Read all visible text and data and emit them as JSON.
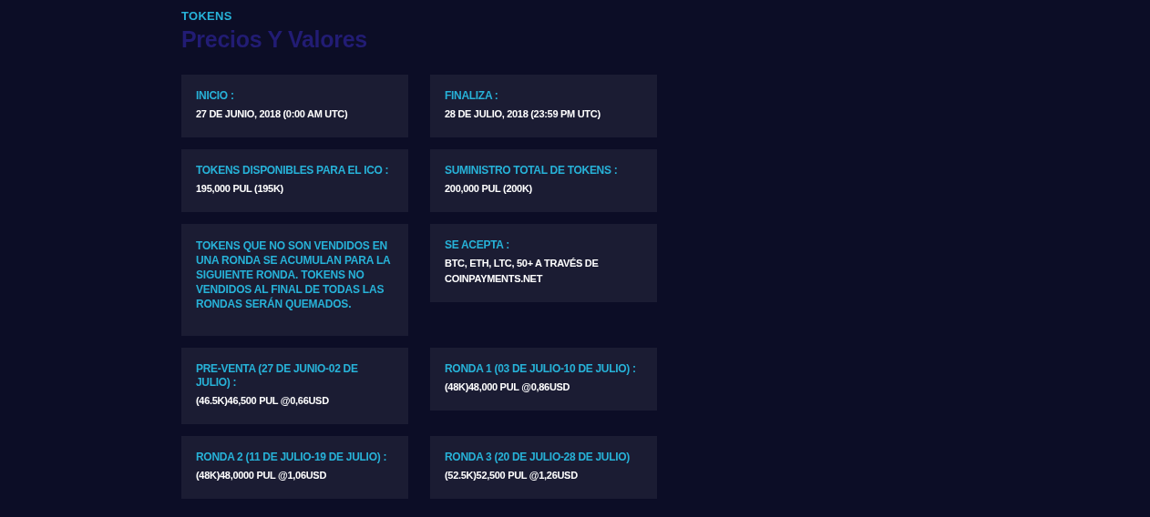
{
  "section_label": "TOKENS",
  "heading": "Precios Y Valores",
  "cards": [
    {
      "kind": "info",
      "title": "INICIO :",
      "value": "27 DE JUNIO, 2018 (0:00 AM UTC)"
    },
    {
      "kind": "info",
      "title": "FINALIZA :",
      "value": "28 DE JULIO, 2018 (23:59 PM UTC)"
    },
    {
      "kind": "info",
      "title": "TOKENS DISPONIBLES PARA EL ICO :",
      "value": "195,000 PUL (195K)"
    },
    {
      "kind": "info",
      "title": "SUMINISTRO TOTAL DE TOKENS :",
      "value": "200,000 PUL (200K)"
    },
    {
      "kind": "note",
      "text": "TOKENS QUE NO SON VENDIDOS EN UNA RONDA SE ACUMULAN PARA LA SIGUIENTE RONDA. TOKENS NO VENDIDOS AL FINAL DE TODAS LAS RONDAS SERÁN QUEMADOS."
    },
    {
      "kind": "info",
      "title": "SE ACEPTA :",
      "value": "BTC, ETH, LTC, 50+ A TRAVÉS DE COINPAYMENTS.NET"
    },
    {
      "kind": "info",
      "title": "PRE-VENTA (27 DE JUNIO-02 DE JULIO) :",
      "value": "(46.5K)46,500 PUL @0,66USD"
    },
    {
      "kind": "info",
      "title": "RONDA 1 (03 DE JULIO-10 DE JULIO) :",
      "value": "(48K)48,000 PUL @0,86USD"
    },
    {
      "kind": "info",
      "title": "RONDA 2 (11 DE JULIO-19 DE JULIO) :",
      "value": "(48K)48,0000 PUL @1,06USD"
    },
    {
      "kind": "info",
      "title": "RONDA 3 (20 DE JULIO-28 DE JULIO)",
      "value": "(52.5K)52,500 PUL @1,26USD"
    }
  ]
}
